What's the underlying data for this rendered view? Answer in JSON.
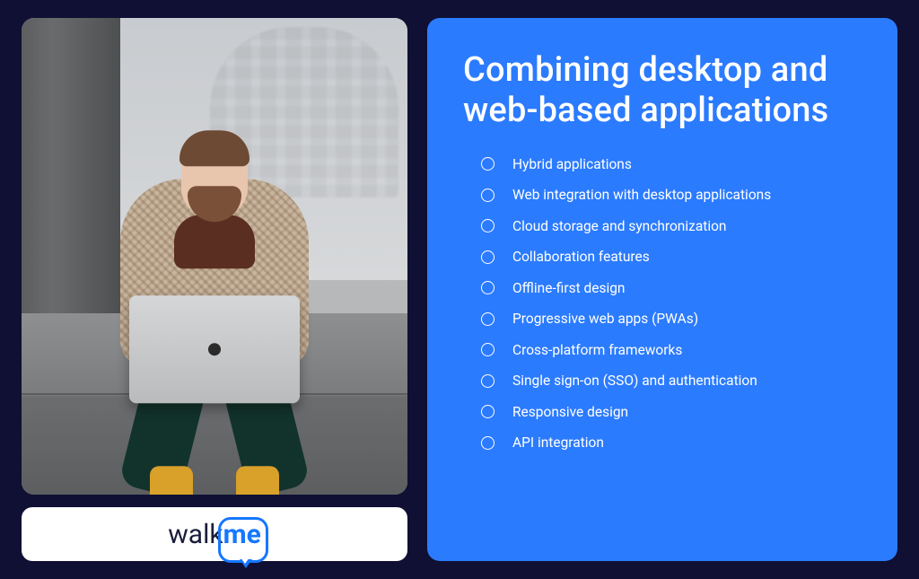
{
  "brand": {
    "logo_part1": "walk",
    "logo_part2": "me"
  },
  "content": {
    "headline": "Combining desktop and web-based applications",
    "items": [
      "Hybrid applications",
      "Web integration with desktop applications",
      "Cloud storage and synchronization",
      "Collaboration features",
      "Offline-first design",
      "Progressive web apps (PWAs)",
      "Cross-platform frameworks",
      "Single sign-on (SSO) and authentication",
      "Responsive design",
      "API integration"
    ]
  },
  "photo": {
    "alt": "Bearded man in plaid coat and mustard socks sitting on stone steps with a laptop"
  },
  "colors": {
    "page_bg": "#0f1033",
    "panel_blue": "#2b7bff",
    "brand_blue": "#1677ff",
    "white": "#ffffff"
  }
}
